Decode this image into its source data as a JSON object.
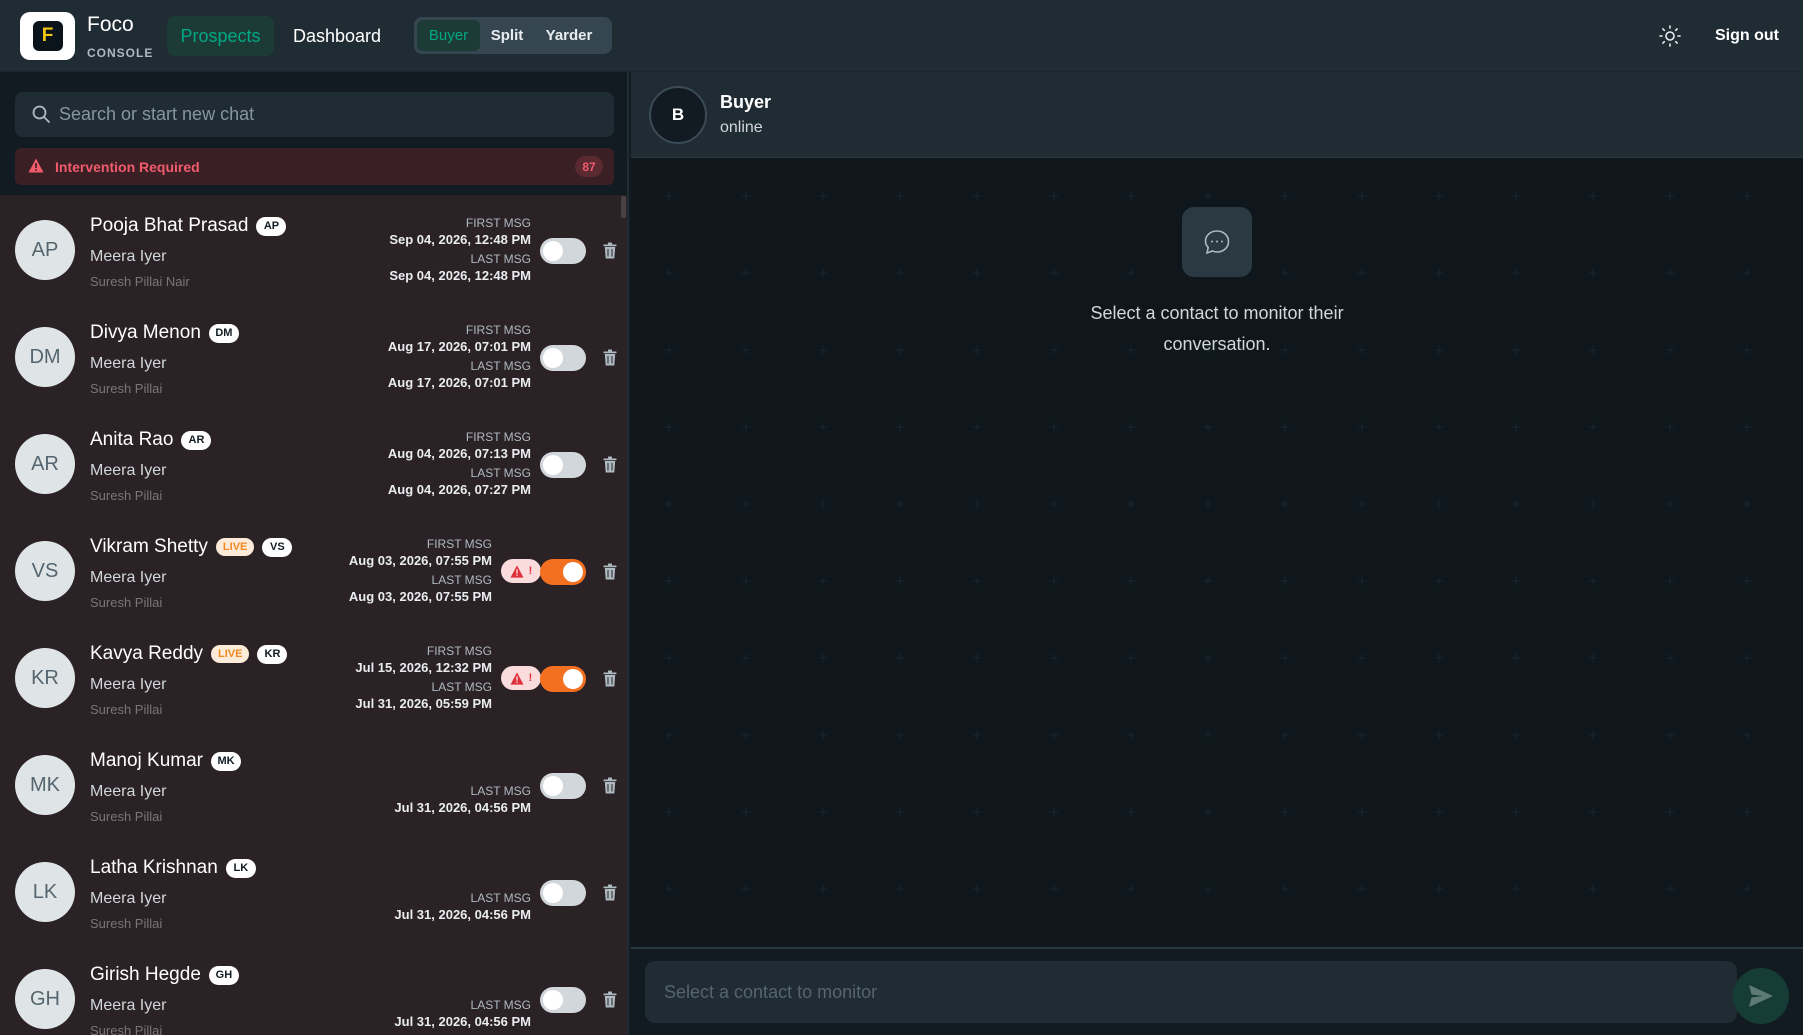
{
  "brand": {
    "letter": "F",
    "name": "Foco",
    "sub": "CONSOLE"
  },
  "nav": {
    "prospects": "Prospects",
    "dashboard": "Dashboard"
  },
  "view_switch": [
    "Buyer",
    "Split",
    "Yarder"
  ],
  "view_switch_active": "Buyer",
  "header_right": {
    "theme_icon": "sun-icon",
    "signout": "Sign out"
  },
  "search": {
    "placeholder": "Search or start new chat"
  },
  "alert": {
    "label": "Intervention Required",
    "count": "87"
  },
  "labels": {
    "first": "FIRST MSG",
    "last": "LAST MSG"
  },
  "contacts": [
    {
      "initials": "AP",
      "name": "Pooja Bhat Prasad",
      "live": false,
      "sub1": "Meera Iyer",
      "sub2": "Suresh Pillai Nair",
      "first": "Sep 04, 2026, 12:48 PM",
      "last": "Sep 04, 2026, 12:48 PM",
      "alert": false,
      "enabled": false
    },
    {
      "initials": "DM",
      "name": "Divya Menon",
      "live": false,
      "sub1": "Meera Iyer",
      "sub2": "Suresh Pillai",
      "first": "Aug 17, 2026, 07:01 PM",
      "last": "Aug 17, 2026, 07:01 PM",
      "alert": false,
      "enabled": false
    },
    {
      "initials": "AR",
      "name": "Anita Rao",
      "live": false,
      "sub1": "Meera Iyer",
      "sub2": "Suresh Pillai",
      "first": "Aug 04, 2026, 07:13 PM",
      "last": "Aug 04, 2026, 07:27 PM",
      "alert": false,
      "enabled": false
    },
    {
      "initials": "VS",
      "name": "Vikram Shetty",
      "live": true,
      "live_label": "LIVE",
      "sub1": "Meera Iyer",
      "sub2": "Suresh Pillai",
      "first": "Aug 03, 2026, 07:55 PM",
      "last": "Aug 03, 2026, 07:55 PM",
      "alert": true,
      "alert_mark": "!",
      "enabled": true
    },
    {
      "initials": "KR",
      "name": "Kavya Reddy",
      "live": true,
      "live_label": "LIVE",
      "sub1": "Meera Iyer",
      "sub2": "Suresh Pillai",
      "first": "Jul 15, 2026, 12:32 PM",
      "last": "Jul 31, 2026, 05:59 PM",
      "alert": true,
      "alert_mark": "!",
      "enabled": true
    },
    {
      "initials": "MK",
      "name": "Manoj Kumar",
      "live": false,
      "sub1": "Meera Iyer",
      "sub2": "Suresh Pillai",
      "first": null,
      "last": "Jul 31, 2026, 04:56 PM",
      "alert": false,
      "enabled": false
    },
    {
      "initials": "LK",
      "name": "Latha Krishnan",
      "live": false,
      "sub1": "Meera Iyer",
      "sub2": "Suresh Pillai",
      "first": null,
      "last": "Jul 31, 2026, 04:56 PM",
      "alert": false,
      "enabled": false
    },
    {
      "initials": "GH",
      "name": "Girish Hegde",
      "live": false,
      "sub1": "Meera Iyer",
      "sub2": "Suresh Pillai",
      "first": null,
      "last": "Jul 31, 2026, 04:56 PM",
      "alert": false,
      "enabled": false
    }
  ],
  "chat": {
    "avatar": "B",
    "name": "Buyer",
    "status": "online",
    "empty_text": "Select a contact to monitor their conversation.",
    "input_placeholder": "Select a contact to monitor"
  },
  "colors": {
    "accent": "#00a884",
    "alert": "#f15c6d",
    "toggle_on": "#f37021"
  }
}
